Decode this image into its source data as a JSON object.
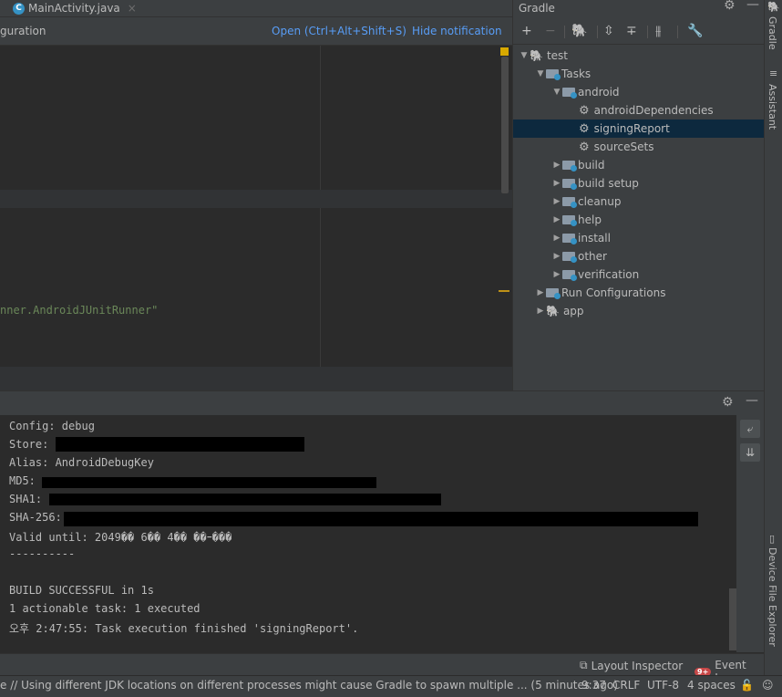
{
  "editor": {
    "tab_name": "MainActivity.java",
    "tab_close": "×",
    "notification": "guration",
    "notification_open": "Open (Ctrl+Alt+Shift+S)",
    "notification_hide": "Hide notification",
    "code_line": "nner.AndroidJUnitRunner\""
  },
  "gradle": {
    "title": "Gradle",
    "toolbar": [
      "+",
      "−",
      "elephant",
      "expand-all",
      "collapse-all",
      "toggle-offline",
      "wrench"
    ],
    "tree": [
      {
        "label": "test",
        "level": 0,
        "expanded": true,
        "icon": "elephant"
      },
      {
        "label": "Tasks",
        "level": 1,
        "expanded": true,
        "icon": "folder"
      },
      {
        "label": "android",
        "level": 2,
        "expanded": true,
        "icon": "folder"
      },
      {
        "label": "androidDependencies",
        "level": 3,
        "icon": "gear"
      },
      {
        "label": "signingReport",
        "level": 3,
        "icon": "gear",
        "selected": true
      },
      {
        "label": "sourceSets",
        "level": 3,
        "icon": "gear"
      },
      {
        "label": "build",
        "level": 2,
        "expanded": false,
        "icon": "folder"
      },
      {
        "label": "build setup",
        "level": 2,
        "expanded": false,
        "icon": "folder"
      },
      {
        "label": "cleanup",
        "level": 2,
        "expanded": false,
        "icon": "folder"
      },
      {
        "label": "help",
        "level": 2,
        "expanded": false,
        "icon": "folder"
      },
      {
        "label": "install",
        "level": 2,
        "expanded": false,
        "icon": "folder"
      },
      {
        "label": "other",
        "level": 2,
        "expanded": false,
        "icon": "folder"
      },
      {
        "label": "verification",
        "level": 2,
        "expanded": false,
        "icon": "folder"
      },
      {
        "label": "Run Configurations",
        "level": 1,
        "expanded": false,
        "icon": "folder"
      },
      {
        "label": "app",
        "level": 1,
        "expanded": false,
        "icon": "elephant"
      }
    ]
  },
  "right_stripe": {
    "gradle": "Gradle",
    "assistant": "Assistant",
    "device_explorer": "Device File Explorer"
  },
  "console": {
    "lines": [
      "Config: debug",
      "Store: ",
      "Alias: AndroidDebugKey",
      "MD5: ",
      "SHA1: ",
      "SHA-256: ",
      "Valid until: 2049�� 6�� 4�� ��ｰ���",
      "----------",
      "",
      "BUILD SUCCESSFUL in 1s",
      "1 actionable task: 1 executed",
      "오후 2:47:55: Task execution finished 'signingReport'."
    ]
  },
  "bottom_tools": {
    "layout_inspector": "Layout Inspector",
    "event_log": "Event Log",
    "event_badge": "9+"
  },
  "status": {
    "message": "e // Using different JDK locations on different processes might cause Gradle to spawn multiple ... (5 minutes ago)",
    "position": "9:37",
    "line_sep": "CRLF",
    "encoding": "UTF-8",
    "indent": "4 spaces"
  }
}
